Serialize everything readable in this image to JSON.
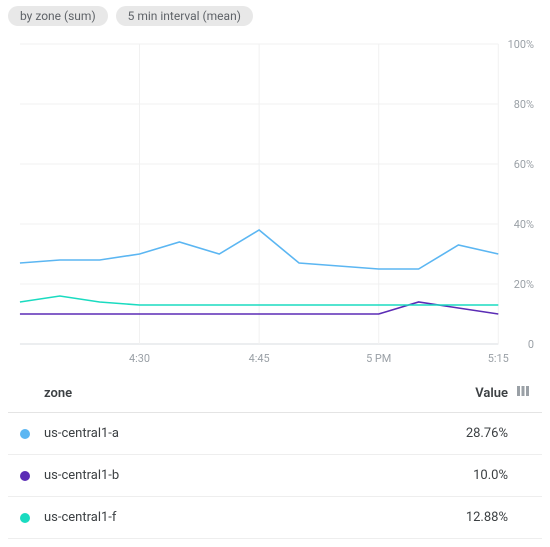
{
  "chips": [
    {
      "label": "by zone (sum)"
    },
    {
      "label": "5 min interval (mean)"
    }
  ],
  "table": {
    "header_zone": "zone",
    "header_value": "Value",
    "header_indicator": "▥",
    "rows": [
      {
        "color": "#5bb6f2",
        "zone": "us-central1-a",
        "value": "28.76%"
      },
      {
        "color": "#5b2cb5",
        "zone": "us-central1-b",
        "value": "10.0%"
      },
      {
        "color": "#1adbc0",
        "zone": "us-central1-f",
        "value": "12.88%"
      }
    ]
  },
  "chart_data": {
    "type": "line",
    "title": "",
    "xlabel": "",
    "ylabel": "",
    "ylim": [
      0,
      100
    ],
    "y_ticks": [
      0,
      20,
      40,
      60,
      80,
      100
    ],
    "y_tick_format": "%",
    "x_tick_labels": [
      "4:30",
      "4:45",
      "5 PM",
      "5:15"
    ],
    "x_tick_positions": [
      3,
      6,
      9,
      12
    ],
    "categories": [
      0,
      1,
      2,
      3,
      4,
      5,
      6,
      7,
      8,
      9,
      10,
      11,
      12
    ],
    "series": [
      {
        "name": "us-central1-a",
        "color": "#5bb6f2",
        "values": [
          27,
          28,
          28,
          30,
          34,
          30,
          38,
          27,
          26,
          25,
          25,
          33,
          30
        ]
      },
      {
        "name": "us-central1-b",
        "color": "#5b2cb5",
        "values": [
          10,
          10,
          10,
          10,
          10,
          10,
          10,
          10,
          10,
          10,
          14,
          12,
          10
        ]
      },
      {
        "name": "us-central1-f",
        "color": "#1adbc0",
        "values": [
          14,
          16,
          14,
          13,
          13,
          13,
          13,
          13,
          13,
          13,
          13,
          13,
          13
        ]
      }
    ]
  }
}
